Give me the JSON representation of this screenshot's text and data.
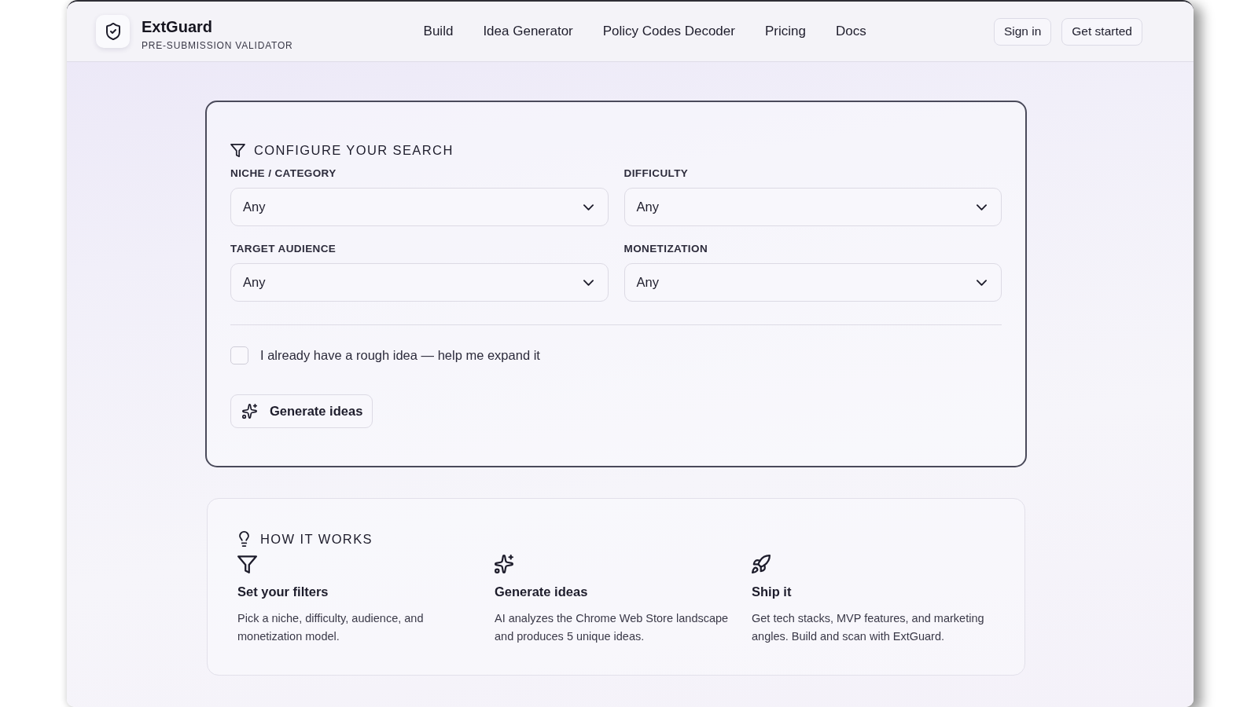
{
  "header": {
    "brand": {
      "name": "ExtGuard",
      "tagline": "PRE-SUBMISSION VALIDATOR"
    },
    "nav": [
      "Build",
      "Idea Generator",
      "Policy Codes Decoder",
      "Pricing",
      "Docs"
    ],
    "actions": [
      "Sign in",
      "Get started"
    ]
  },
  "search_card": {
    "title": "CONFIGURE YOUR SEARCH",
    "fields": [
      {
        "label": "NICHE / CATEGORY",
        "value": "Any"
      },
      {
        "label": "DIFFICULTY",
        "value": "Any"
      },
      {
        "label": "TARGET AUDIENCE",
        "value": "Any"
      },
      {
        "label": "MONETIZATION",
        "value": "Any"
      }
    ],
    "rough_idea": {
      "label": "I already have a rough idea — help me expand it",
      "checked": false
    },
    "button": "Generate ideas"
  },
  "how_it_works": {
    "title": "HOW IT WORKS",
    "steps": [
      {
        "kind": "filter",
        "title": "Set your filters",
        "text": "Pick a niche, difficulty, audience, and monetization model."
      },
      {
        "kind": "sparkles",
        "title": "Generate ideas",
        "text": "AI analyzes the Chrome Web Store landscape and produces 5 unique ideas."
      },
      {
        "kind": "rocket",
        "title": "Ship it",
        "text": "Get tech stacks, MVP features, and marketing angles. Build and scan with ExtGuard."
      }
    ]
  }
}
